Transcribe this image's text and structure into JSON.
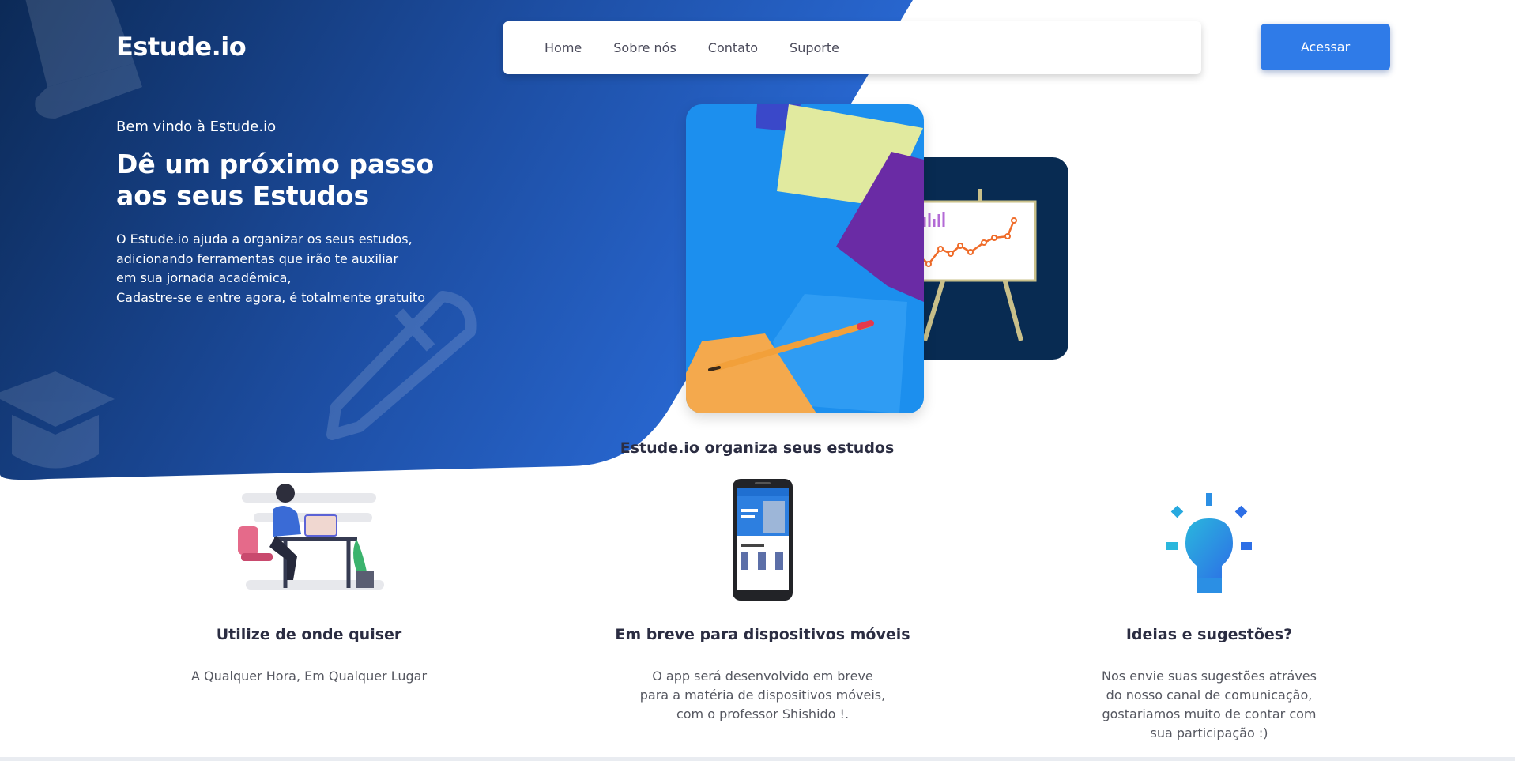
{
  "brand": {
    "name": "Estude.io"
  },
  "nav": {
    "links": [
      "Home",
      "Sobre nós",
      "Contato",
      "Suporte"
    ]
  },
  "header": {
    "access_button": "Acessar"
  },
  "hero": {
    "welcome": "Bem vindo à Estude.io",
    "headline_line1": "Dê um próximo passo",
    "headline_line2": "aos seus Estudos",
    "description_lines": [
      "O Estude.io ajuda a organizar os seus estudos,",
      "adicionando ferramentas que irão te auxiliar",
      "em sua jornada acadêmica,",
      "Cadastre-se e entre agora, é totalmente gratuito"
    ]
  },
  "colors": {
    "hero_gradient_start": "#0c2a57",
    "hero_gradient_end": "#2763cf",
    "accent": "#2f7be8",
    "heading": "#2b2d42"
  },
  "section": {
    "title": "Estude.io organiza seus estudos"
  },
  "features": [
    {
      "icon": "person-at-desk-illustration",
      "title": "Utilize de onde quiser",
      "text_lines": [
        "A Qualquer Hora, Em Qualquer Lugar"
      ]
    },
    {
      "icon": "mobile-phone-illustration",
      "title": "Em breve para dispositivos móveis",
      "text_lines": [
        "O app será desenvolvido em breve",
        "para a matéria de dispositivos móveis,",
        "com o professor Shishido !."
      ]
    },
    {
      "icon": "lightbulb-icon",
      "title": "Ideias e sugestões?",
      "text_lines": [
        "Nos envie suas sugestões atráves",
        "do nosso canal de comunicação,",
        "gostariamos muito de contar com",
        "sua participação :)"
      ]
    }
  ]
}
